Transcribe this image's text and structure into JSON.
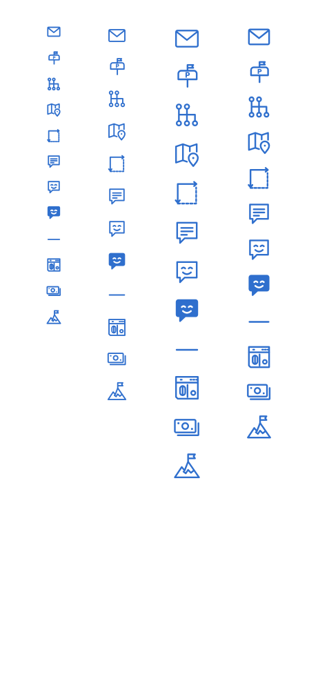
{
  "colors": {
    "icon": "#2f6fcd",
    "background": "#ffffff"
  },
  "icon_sets": [
    {
      "name": "set-small",
      "icons": [
        "mail-icon",
        "mailbox-icon",
        "hierarchy-icon",
        "map-location-icon",
        "resize-icon",
        "chat-text-icon",
        "chat-smile-outline-icon",
        "chat-smile-filled-icon",
        "minus-icon",
        "floppy-safe-icon",
        "cash-icon",
        "mountain-flag-icon"
      ]
    },
    {
      "name": "set-medium",
      "icons": [
        "mail-icon",
        "mailbox-icon",
        "hierarchy-icon",
        "map-location-icon",
        "resize-icon",
        "chat-text-icon",
        "chat-smile-outline-icon",
        "chat-smile-filled-icon",
        "minus-icon",
        "floppy-safe-icon",
        "cash-icon",
        "mountain-flag-icon"
      ]
    },
    {
      "name": "set-large",
      "icons": [
        "mail-icon",
        "mailbox-icon",
        "hierarchy-icon",
        "map-location-icon",
        "resize-icon",
        "chat-text-icon",
        "chat-smile-outline-icon",
        "chat-smile-filled-icon",
        "minus-icon",
        "floppy-safe-icon",
        "cash-icon",
        "mountain-flag-icon"
      ]
    },
    {
      "name": "set-bold",
      "icons": [
        "mail-icon",
        "mailbox-icon",
        "hierarchy-icon",
        "map-location-icon",
        "resize-icon",
        "chat-text-icon",
        "chat-smile-outline-icon",
        "chat-smile-filled-icon",
        "minus-icon",
        "floppy-safe-icon",
        "cash-icon",
        "mountain-flag-icon"
      ]
    }
  ]
}
